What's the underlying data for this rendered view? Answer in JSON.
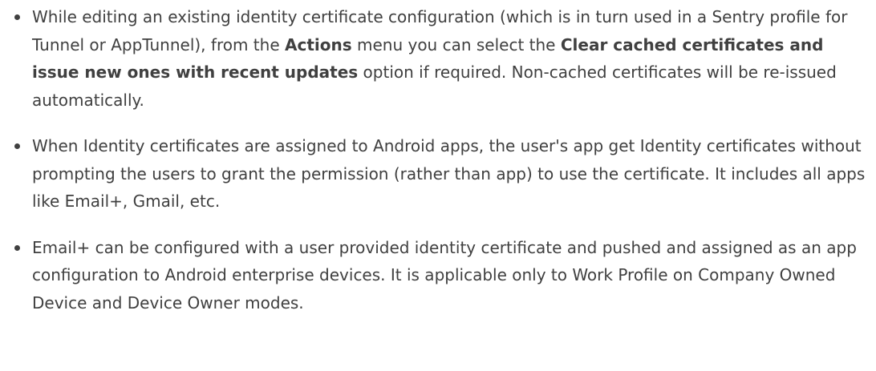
{
  "bullets": [
    {
      "parts": [
        {
          "text": "While editing an existing identity certificate configuration (which is in turn used in a Sentry profile for Tunnel or AppTunnel), from the ",
          "bold": false
        },
        {
          "text": "Actions",
          "bold": true
        },
        {
          "text": " menu you can select the ",
          "bold": false
        },
        {
          "text": "Clear cached certificates and issue new ones with recent updates",
          "bold": true
        },
        {
          "text": " option if required. Non-cached certificates will be re-issued automatically.",
          "bold": false
        }
      ]
    },
    {
      "parts": [
        {
          "text": "When Identity certificates are assigned to Android apps, the user's app get Identity certificates without prompting the users to grant the permission (rather than app) to use the certificate. It includes all apps like Email+, Gmail, etc.",
          "bold": false
        }
      ]
    },
    {
      "parts": [
        {
          "text": "Email+ can be configured with a user provided identity certificate and pushed and assigned as an app configuration to Android enterprise devices. It is applicable only to Work Profile on Company Owned Device and Device Owner modes.",
          "bold": false
        }
      ]
    }
  ]
}
